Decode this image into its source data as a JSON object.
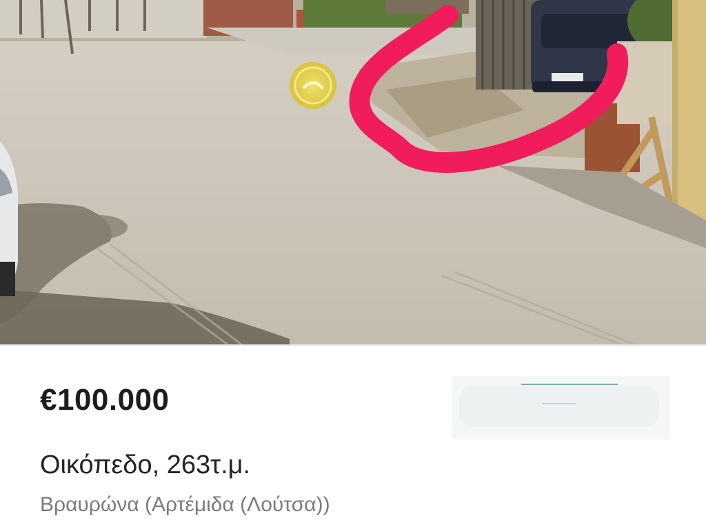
{
  "listing": {
    "price": "€100.000",
    "title": "Οικόπεδο, 263τ.μ.",
    "location": "Βραυρώνα (Αρτέμιδα (Λούτσα))"
  },
  "photo": {
    "annotation_color": "#f01c5c",
    "watermark_color": "#e9d43a"
  }
}
